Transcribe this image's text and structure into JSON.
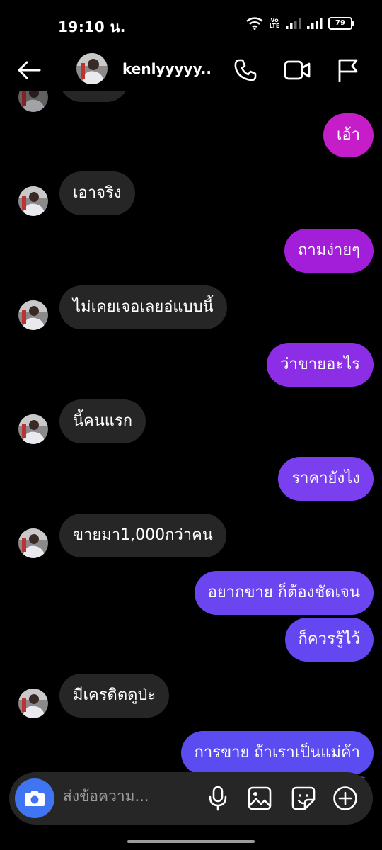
{
  "status_bar": {
    "time": "19:10 น.",
    "volte": "Vo LTE",
    "battery": "79"
  },
  "header": {
    "name": "kenlyyyyy..."
  },
  "messages": [
    {
      "dir": "out",
      "text": "เอ้า"
    },
    {
      "dir": "in",
      "text": "เอาจริง"
    },
    {
      "dir": "out",
      "text": "ถามง่ายๆ"
    },
    {
      "dir": "in",
      "text": "ไม่เคยเจอเลยอ่แบบนี้"
    },
    {
      "dir": "out",
      "text": "ว่าขายอะไร"
    },
    {
      "dir": "in",
      "text": "นี้คนแรก"
    },
    {
      "dir": "out",
      "text": "ราคายังไง"
    },
    {
      "dir": "in",
      "text": "ขายมา1,000กว่าคน"
    },
    {
      "dir": "out",
      "text": "อยากขาย ก็ต้องชัดเจน"
    },
    {
      "dir": "out",
      "text": "ก็ควรรู้ไว้"
    },
    {
      "dir": "in",
      "text": "มีเครดิตดูป่ะ"
    },
    {
      "dir": "out",
      "text": "การขาย ถ้าเราเป็นแม่ค้า"
    }
  ],
  "composer": {
    "placeholder": "ส่งข้อความ..."
  },
  "colors": {
    "incoming": "#262626",
    "outgoing_top": "#c51ec9",
    "outgoing_bottom": "#5b4cf2",
    "camera": "#3f74f2"
  },
  "icons": [
    "back-arrow-icon",
    "voice-call-icon",
    "video-call-icon",
    "flag-icon",
    "camera-icon",
    "microphone-icon",
    "gallery-icon",
    "sticker-icon",
    "add-icon"
  ]
}
